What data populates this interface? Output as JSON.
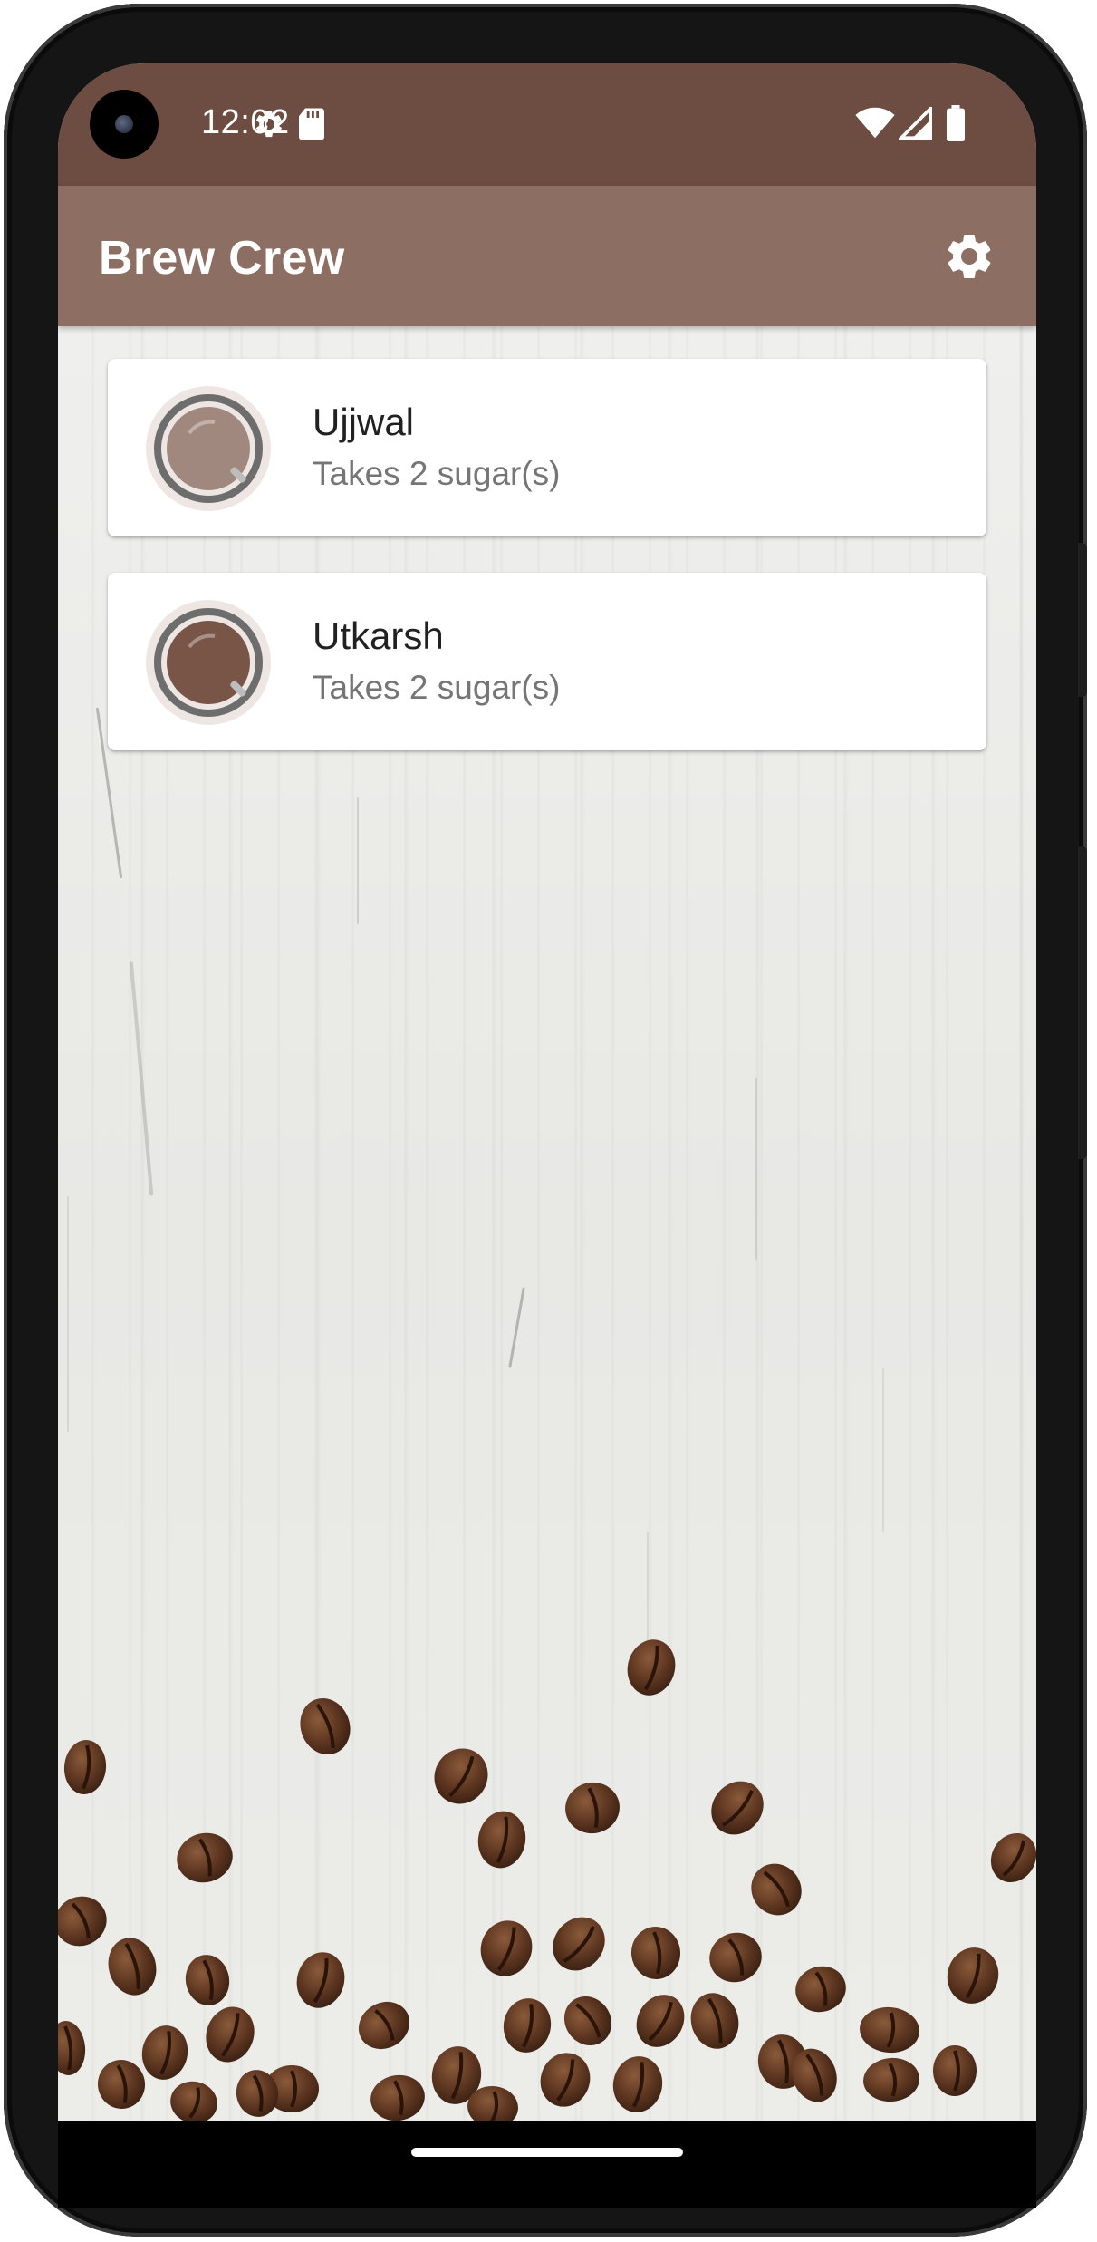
{
  "status_bar": {
    "time": "12:02",
    "icons": [
      "settings-gear-icon",
      "sd-card-icon",
      "wifi-icon",
      "cellular-signal-icon",
      "battery-icon"
    ]
  },
  "app_bar": {
    "title": "Brew Crew",
    "settings_icon": "gear-icon"
  },
  "brews": [
    {
      "name": "Ujjwal",
      "subtitle": "Takes 2 sugar(s)",
      "cup_color": "#a1887f"
    },
    {
      "name": "Utkarsh",
      "subtitle": "Takes 2 sugar(s)",
      "cup_color": "#795548"
    }
  ],
  "colors": {
    "status_bar": "#6d4c41",
    "app_bar": "#8d6e63"
  }
}
